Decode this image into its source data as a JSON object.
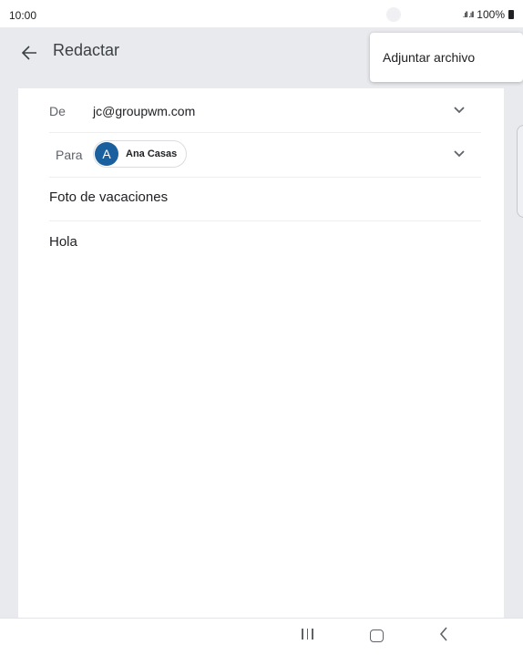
{
  "status_bar": {
    "time": "10:00",
    "signal": ".ıll .ıll",
    "battery": "100%",
    "battery_icon": "battery-icon"
  },
  "app_bar": {
    "title": "Redactar",
    "back_icon": "arrow-back-icon"
  },
  "overflow_menu": {
    "items": [
      {
        "label": "Adjuntar archivo"
      }
    ]
  },
  "compose": {
    "from_label": "De",
    "from_value": "jc@groupwm.com",
    "to_label": "Para",
    "to_chip": {
      "initial": "A",
      "name": "Ana Casas",
      "avatar_color": "#1a5f9e"
    },
    "subject": "Foto de vacaciones",
    "body": "Hola"
  },
  "nav_bar": {
    "recents_icon": "recents-icon",
    "home_icon": "home-icon",
    "back_icon": "back-icon"
  }
}
